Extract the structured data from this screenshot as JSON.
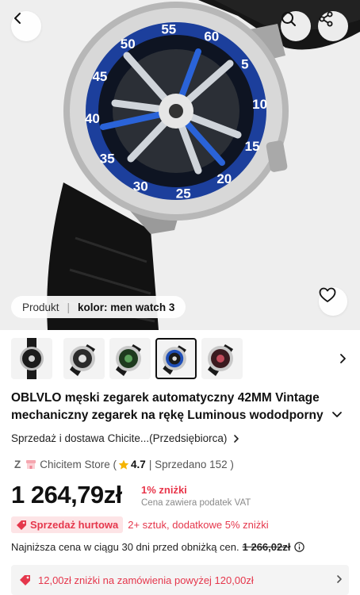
{
  "hero": {
    "dial_numbers": [
      "5",
      "10",
      "15",
      "20",
      "25",
      "30",
      "35",
      "40",
      "45",
      "50",
      "55",
      "60"
    ],
    "variant_label": "Produkt",
    "variant_value": "kolor: men watch 3"
  },
  "icons": {
    "back": "chevron-left-icon",
    "search": "search-icon",
    "share": "share-icon",
    "wishlist": "heart-icon",
    "thumbs_next": "chevron-right-icon"
  },
  "thumbnails": [
    {
      "variant": "black",
      "selected": false
    },
    {
      "variant": "silver",
      "selected": false
    },
    {
      "variant": "green",
      "selected": false
    },
    {
      "variant": "blue",
      "selected": true
    },
    {
      "variant": "red",
      "selected": false
    }
  ],
  "product": {
    "title": "OBLVLO męski zegarek automatyczny 42MM Vintage mechaniczny zegarek na rękę Luminous wododporny",
    "seller_line": "Sprzedaż i dostawa Chicite...(Przedsiębiorca)",
    "store_prefix": "Z",
    "store_name": "Chicitem Store (",
    "rating": "4.7",
    "sold": "| Sprzedano 152 )"
  },
  "price": {
    "current": "1 264,79zł",
    "discount": "1% zniżki",
    "tax_note": "Cena zawiera podatek VAT"
  },
  "wholesale": {
    "badge": "Sprzedaż hurtowa",
    "text": "2+ sztuk, dodatkowe 5% zniżki"
  },
  "lowest_price": {
    "text": "Najniższa cena w ciągu 30 dni przed obniżką cen.",
    "old_price": "1 266,02zł"
  },
  "coupon": {
    "text": "12,00zł zniżki na zamówienia powyżej 120,00zł"
  },
  "colors": {
    "accent_red": "#e5374c",
    "badge_bg": "#fde4e6",
    "watch_blue": "#1f4fb8"
  }
}
